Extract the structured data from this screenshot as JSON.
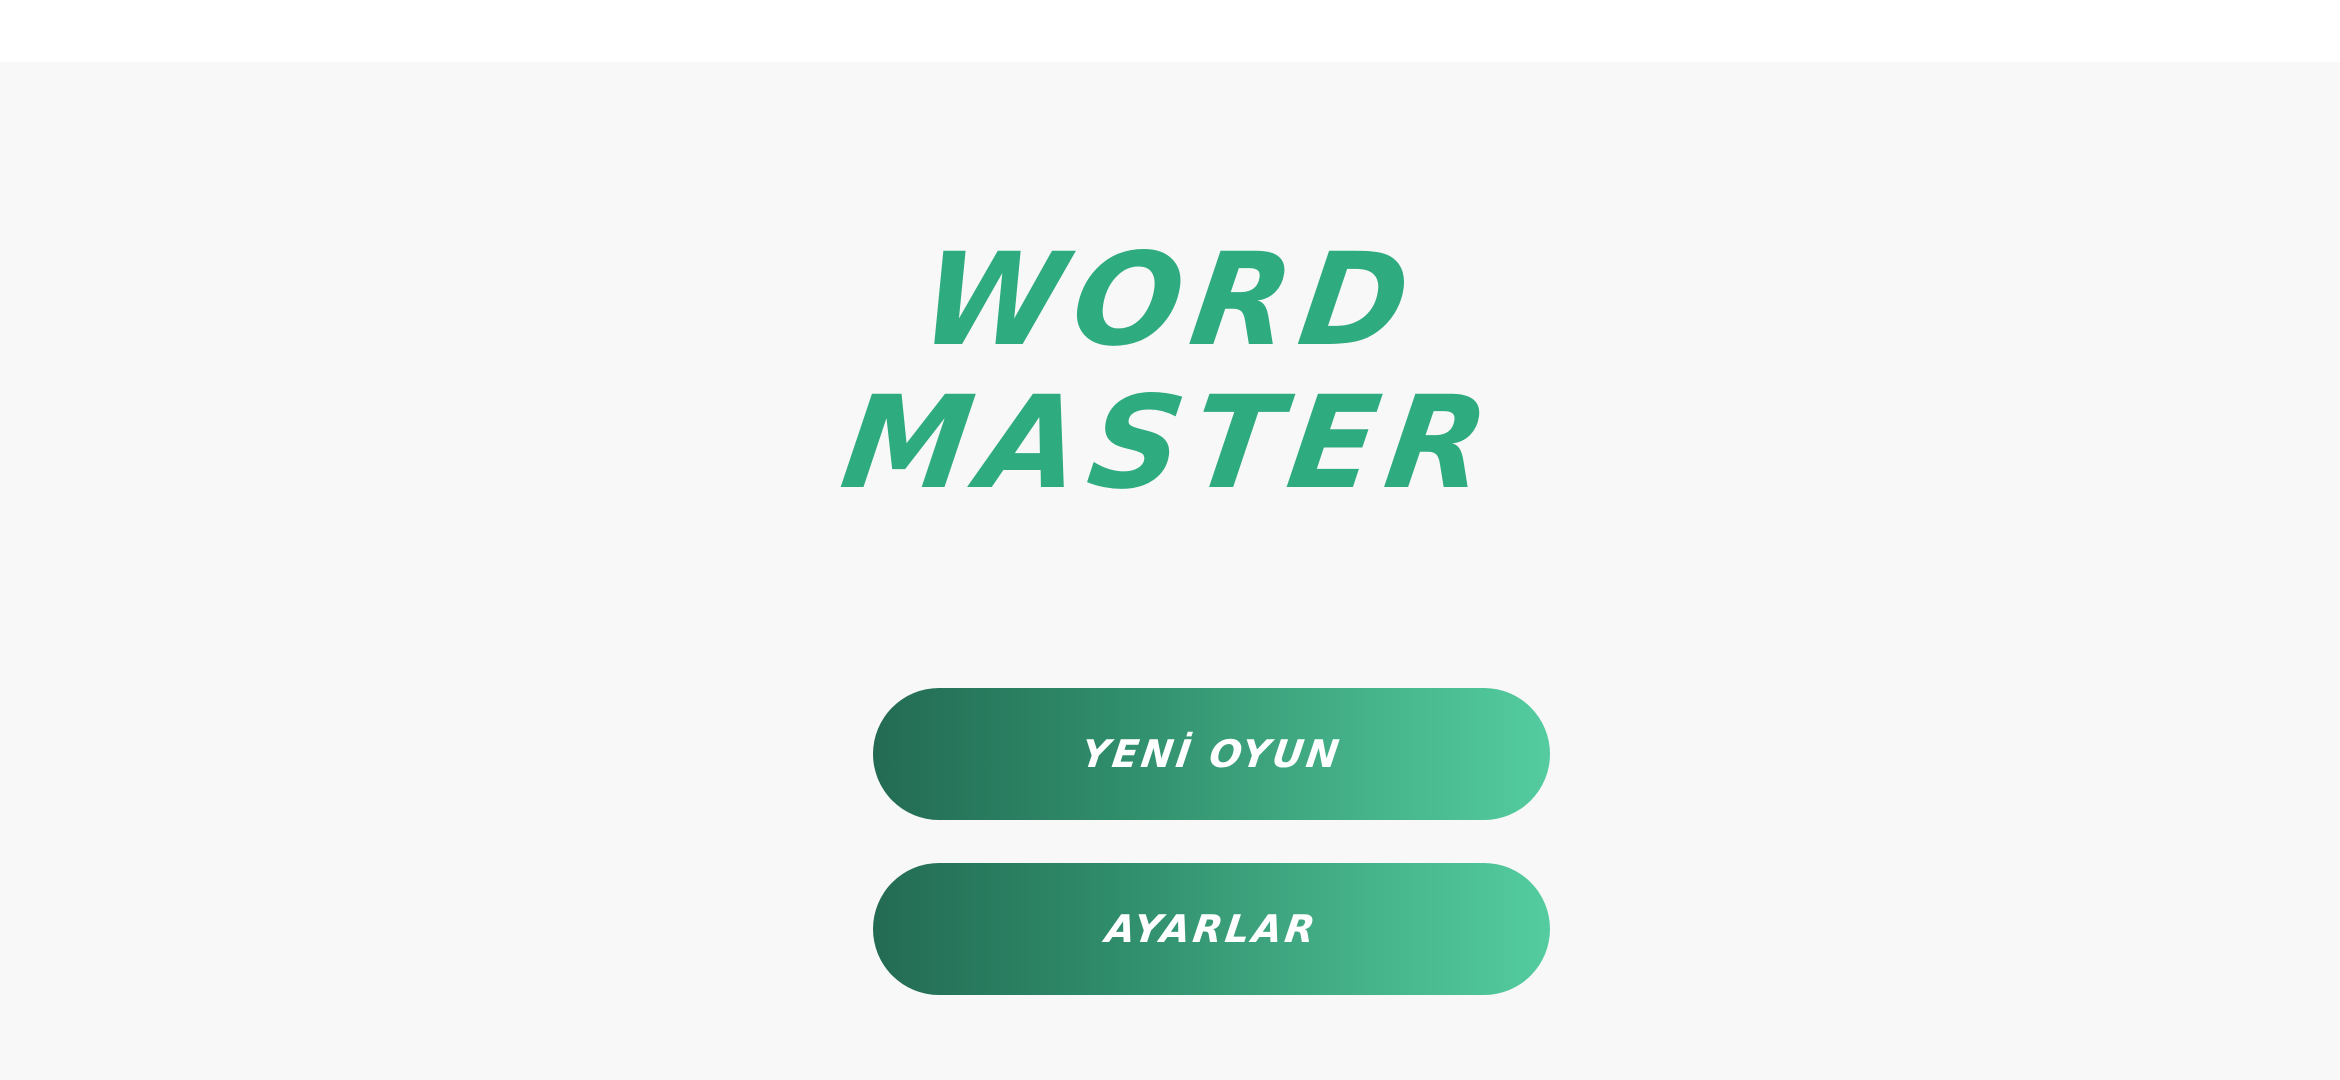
{
  "title": {
    "line1": "WORD",
    "line2": "MASTER",
    "color": "#2fab80"
  },
  "menu": {
    "new_game_label": "YENİ OYUN",
    "settings_label": "AYARLAR",
    "gradient_start": "#236b53",
    "gradient_end": "#54cca0"
  }
}
